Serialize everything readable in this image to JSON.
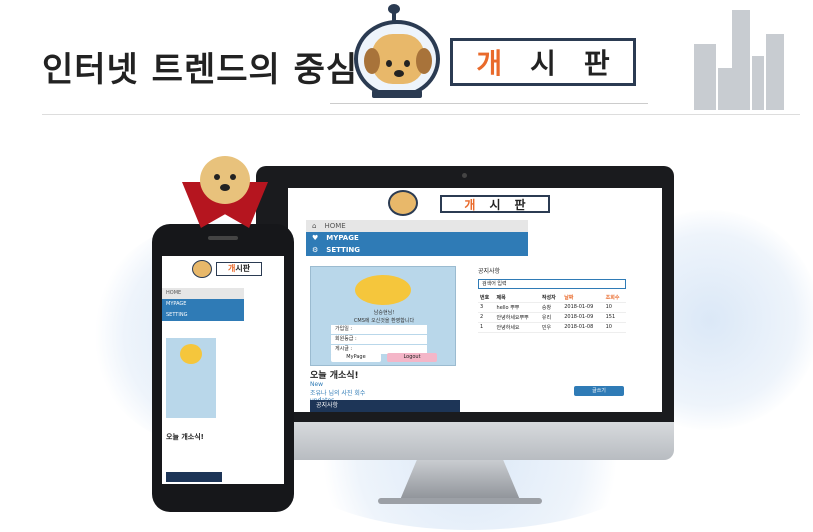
{
  "header": {
    "title": "인터넷 트렌드의 중심",
    "board_chars": [
      "개",
      "시",
      "판"
    ],
    "accent": "#e96a2b"
  },
  "site": {
    "nav": [
      "HOME",
      "MYPAGE",
      "SETTING"
    ],
    "profile": {
      "greeting": "남승현님!",
      "welcome": "CMS에 오신것을 환영합니다",
      "rows": [
        "가입일 :",
        "회원등급 :",
        "게시글 :"
      ],
      "mypage_button": "MyPage",
      "logout_button": "Logout"
    },
    "news": {
      "title": "오늘 개소식!",
      "new_label": "New",
      "line": "조유나 님의 사진 회수",
      "updates_label": "updates"
    },
    "notice_label": "공지사항",
    "board": {
      "title": "공지사항",
      "search_placeholder": "검색어 입력",
      "columns": [
        "번호",
        "제목",
        "작성자",
        "날짜",
        "조회수"
      ],
      "rows": [
        [
          "3",
          "hello 뿌뿌",
          "승창",
          "2018-01-09",
          "10"
        ],
        [
          "2",
          "안녕하세요뿌뿌",
          "유리",
          "2018-01-09",
          "151"
        ],
        [
          "1",
          "안녕하세요",
          "민우",
          "2018-01-08",
          "10"
        ]
      ],
      "write_button": "글쓰기"
    }
  },
  "colors": {
    "primary_blue": "#2f7bb6",
    "navy": "#1d3557",
    "card_blue": "#b9d7ea",
    "cape_red": "#b5151f"
  }
}
